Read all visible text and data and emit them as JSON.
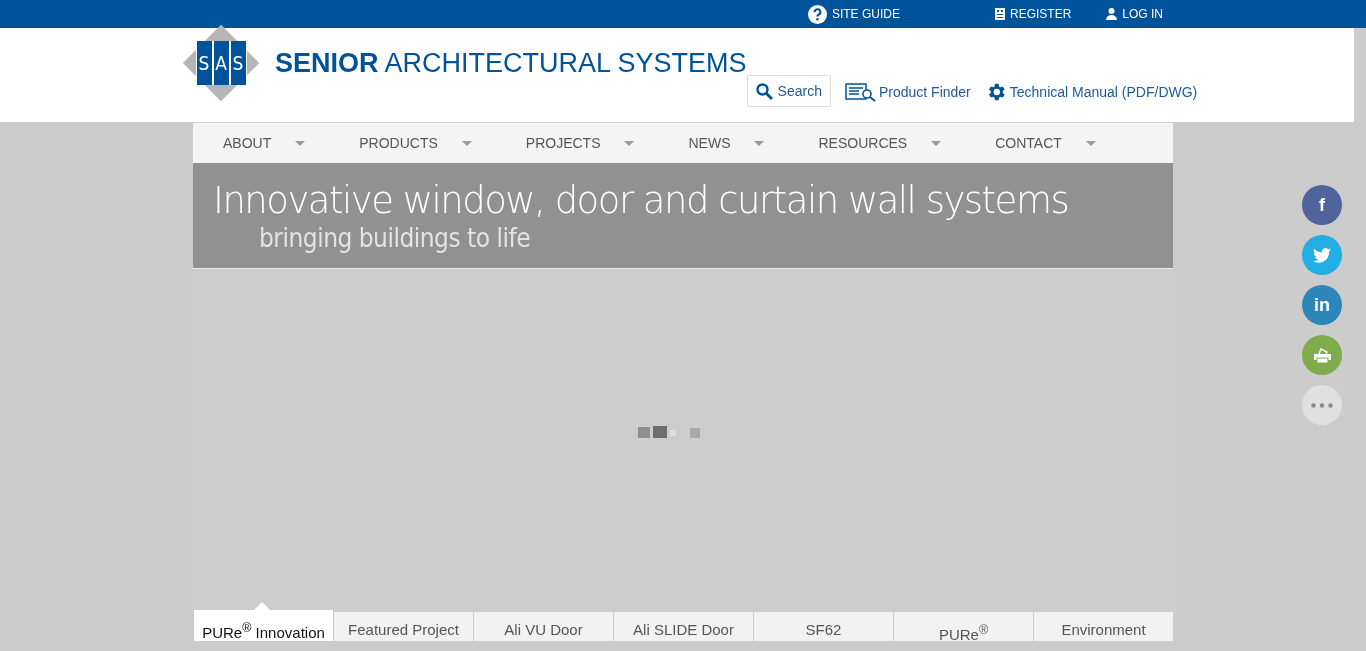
{
  "top_bar": {
    "links": [
      {
        "kind": "help",
        "label": "SITE GUIDE"
      },
      {
        "kind": "register",
        "label": "REGISTER"
      },
      {
        "kind": "user",
        "label": "LOG IN"
      }
    ]
  },
  "header": {
    "logo_letters": [
      "S",
      "A",
      "S"
    ],
    "brand_bold": "SENIOR",
    "brand_rest": "ARCHITECTURAL SYSTEMS",
    "tools": [
      {
        "kind": "search",
        "label": "Search"
      },
      {
        "kind": "finder",
        "label": "Product Finder"
      },
      {
        "kind": "gear",
        "label": "Technical Manual (PDF/DWG)"
      }
    ]
  },
  "nav": {
    "items": [
      "ABOUT",
      "PRODUCTS",
      "PROJECTS",
      "NEWS",
      "RESOURCES",
      "CONTACT"
    ]
  },
  "banner": {
    "title": "Innovative window, door and curtain wall systems",
    "subtitle": "bringing buildings to life"
  },
  "tabs": [
    {
      "label": "PURe$^{®}$ Innovation",
      "selected": true
    },
    {
      "label": "Featured Project",
      "selected": false
    },
    {
      "label": "Ali VU Door",
      "selected": false
    },
    {
      "label": "Ali SLIDE Door",
      "selected": false
    },
    {
      "label": "SF62",
      "selected": false
    },
    {
      "label": "PURe$^{®}$",
      "selected": false
    },
    {
      "label": "Environment",
      "selected": false
    }
  ],
  "social": [
    {
      "kind": "facebook",
      "label": "f",
      "color": "#4f639d"
    },
    {
      "kind": "twitter",
      "color": "#22ade5"
    },
    {
      "kind": "linkedin",
      "label": "in",
      "color": "#2d86b9"
    },
    {
      "kind": "print",
      "color": "#7eab4b"
    },
    {
      "kind": "more",
      "color": "#e0e0e0"
    }
  ]
}
